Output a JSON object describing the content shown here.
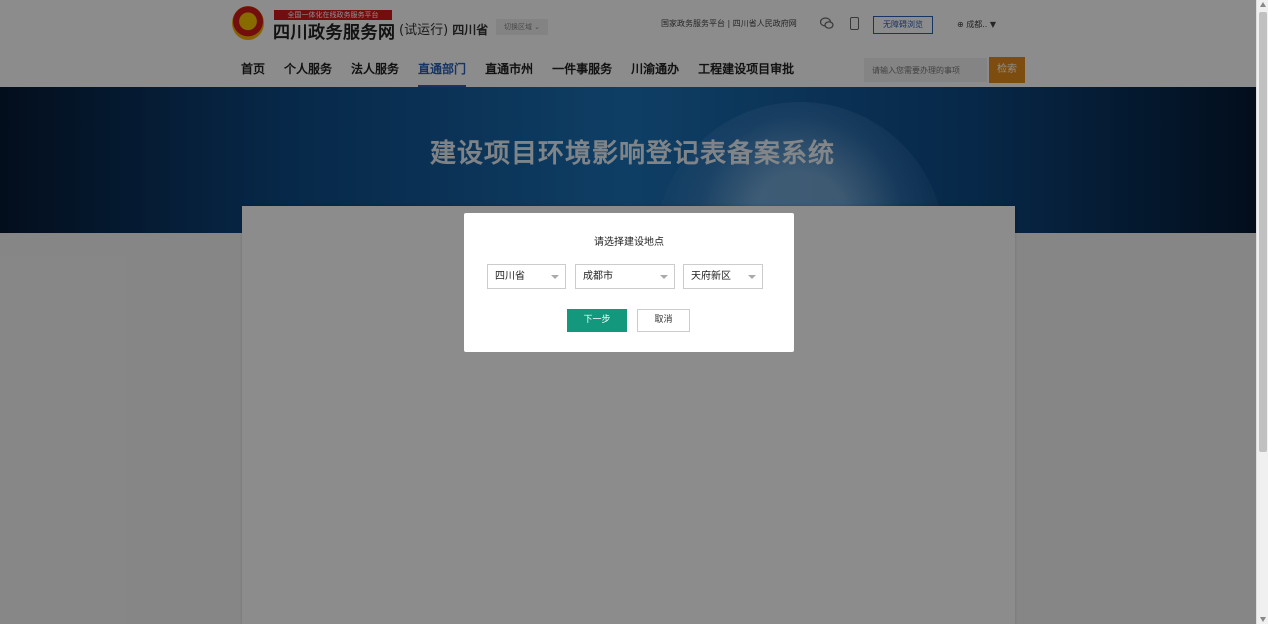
{
  "header": {
    "badge_text": "全国一体化在线政务服务平台",
    "site_title": "四川政务服务网",
    "suffix": "(试运行)",
    "province": "四川省",
    "switch_region": "切换区域 ⌄",
    "top_links": "国家政务服务平台 | 四川省人民政府网",
    "accessibility": "无障碍浏览",
    "location": "⊕ 成都.. ▼"
  },
  "nav": {
    "items": [
      "首页",
      "个人服务",
      "法人服务",
      "直通部门",
      "直通市州",
      "一件事服务",
      "川渝通办",
      "工程建设项目审批"
    ],
    "active_index": 3
  },
  "search": {
    "placeholder": "请输入您需要办理的事项",
    "button": "检索"
  },
  "banner": {
    "title": "建设项目环境影响登记表备案系统"
  },
  "modal": {
    "title": "请选择建设地点",
    "province": "四川省",
    "city": "成都市",
    "district": "天府新区",
    "next": "下一步",
    "cancel": "取消"
  },
  "colors": {
    "primary": "#2b5fb8",
    "search_button": "#e28c1c",
    "next_button": "#13977d",
    "emblem_red": "#d21b1b"
  }
}
